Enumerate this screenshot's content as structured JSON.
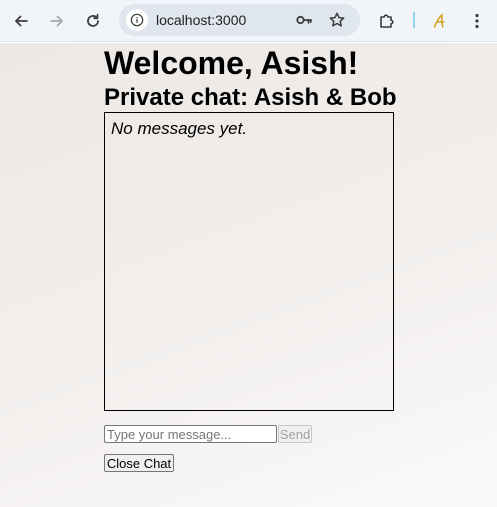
{
  "browser": {
    "url": "localhost:3000",
    "icons": {
      "back": "arrow-left-icon",
      "forward": "arrow-right-icon",
      "reload": "reload-icon",
      "site_info": "site-info-icon",
      "password_key": "key-icon",
      "bookmark": "star-icon",
      "extensions": "puzzle-icon",
      "profile": "profile-script-a-icon",
      "menu": "kebab-menu-icon"
    }
  },
  "page": {
    "welcome_heading": "Welcome, Asish!",
    "chat_title": "Private chat: Asish & Bob",
    "empty_message": "No messages yet.",
    "message_input": {
      "value": "",
      "placeholder": "Type your message..."
    },
    "send_label": "Send",
    "close_label": "Close Chat"
  }
}
